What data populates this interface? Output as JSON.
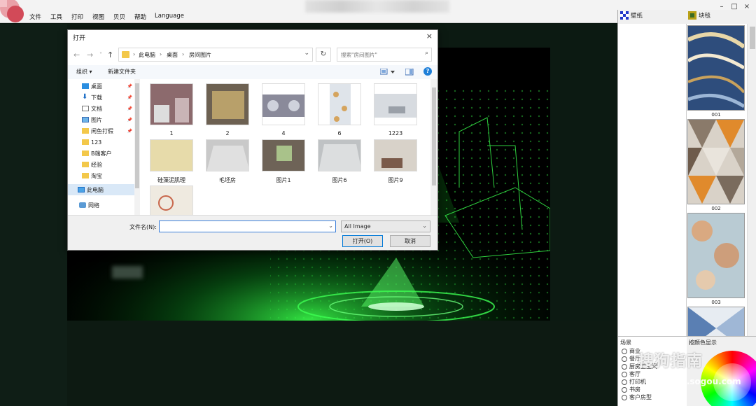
{
  "menubar": {
    "items": [
      "文件",
      "工具",
      "打印",
      "视图",
      "贝贝",
      "帮助",
      "Language"
    ],
    "window_controls": [
      "–",
      "□",
      "×"
    ]
  },
  "right_panel": {
    "tab1": "壁纸",
    "tab2": "块毯",
    "swatches": [
      "001",
      "002",
      "003"
    ],
    "scene_title": "场景",
    "scene_options": [
      "商业",
      "餐厅",
      "厨房卫生间",
      "客厅",
      "打印机",
      "书房",
      "客户房型"
    ],
    "color_title": "按颜色显示"
  },
  "watermark": {
    "text": "搜狗指南",
    "url": "zhinan.sogou.com"
  },
  "dialog": {
    "title": "打开",
    "close": "×",
    "breadcrumbs": [
      "此电脑",
      "桌面",
      "房间图片"
    ],
    "search_placeholder": "搜索\"房间图片\"",
    "toolbar_organize": "组织 ▾",
    "toolbar_new_folder": "新建文件夹",
    "nav_items": [
      {
        "label": "桌面",
        "pinned": true
      },
      {
        "label": "下载",
        "pinned": true
      },
      {
        "label": "文档",
        "pinned": true
      },
      {
        "label": "图片",
        "pinned": true
      },
      {
        "label": "闲鱼打假",
        "pinned": true
      },
      {
        "label": "123",
        "pinned": false
      },
      {
        "label": "B端客户",
        "pinned": false
      },
      {
        "label": "经验",
        "pinned": false
      },
      {
        "label": "淘宝",
        "pinned": false
      },
      {
        "label": "此电脑",
        "pinned": false
      },
      {
        "label": "网络",
        "pinned": false
      }
    ],
    "files": [
      "1",
      "2",
      "4",
      "6",
      "1223",
      "硅藻泥肌理",
      "毛坯房",
      "图片1",
      "图片6",
      "图片9",
      ""
    ],
    "filename_label": "文件名(N):",
    "filename_value": "",
    "filetype_value": "All Image",
    "open_button": "打开(O)",
    "cancel_button": "取消"
  }
}
